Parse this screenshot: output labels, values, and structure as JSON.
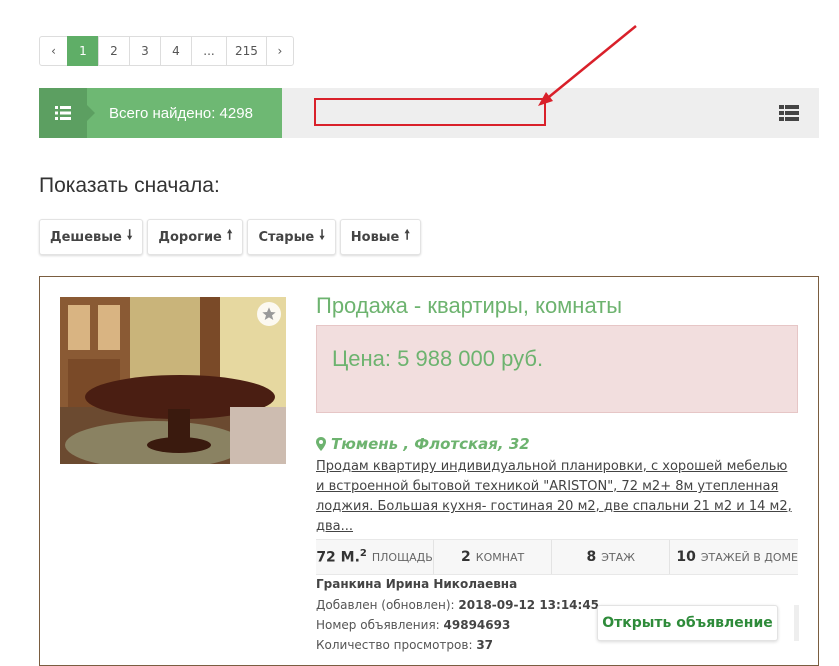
{
  "pagination": {
    "prev": "‹",
    "pages": [
      "1",
      "2",
      "3",
      "4",
      "...",
      "215"
    ],
    "active": "1",
    "next": "›"
  },
  "results": {
    "found_text": "Всего найдено: 4298"
  },
  "sort": {
    "title": "Показать сначала:",
    "buttons": [
      {
        "label": "Дешевые",
        "arrow": "down"
      },
      {
        "label": "Дорогие",
        "arrow": "up"
      },
      {
        "label": "Старые",
        "arrow": "down"
      },
      {
        "label": "Новые",
        "arrow": "up"
      }
    ]
  },
  "listing": {
    "title": "Продажа - квартиры, комнаты",
    "price": "Цена: 5 988 000 руб.",
    "address": "Тюмень , Флотская, 32",
    "description": "Продам квартиру индивидуальной планировки, с хорошей мебелью и встроенной бытовой техникой \"ARISTON\", 72 м2+ 8м утепленная лоджия. Большая кухня- гостиная 20 м2, две спальни 21 м2 и 14 м2, два...",
    "stats": {
      "area_value": "72 М.",
      "area_sup": "2",
      "area_label": "площадь",
      "rooms_value": "2",
      "rooms_label": "комнат",
      "floor_value": "8",
      "floor_label": "этаж",
      "floors_value": "10",
      "floors_label": "этажей в доме"
    },
    "owner": "Гранкина Ирина Николаевна",
    "added_label": "Добавлен (обновлен):",
    "added_value": "2018-09-12 13:14:45",
    "number_label": "Номер объявления:",
    "number_value": "49894693",
    "views_label": "Количество просмотров:",
    "views_value": "37",
    "open_button": "Открыть объявление"
  },
  "colors": {
    "accent_green": "#6eb873",
    "dark_green": "#5c9f61",
    "price_bg": "#f2dede",
    "annotation_red": "#d9202a"
  }
}
